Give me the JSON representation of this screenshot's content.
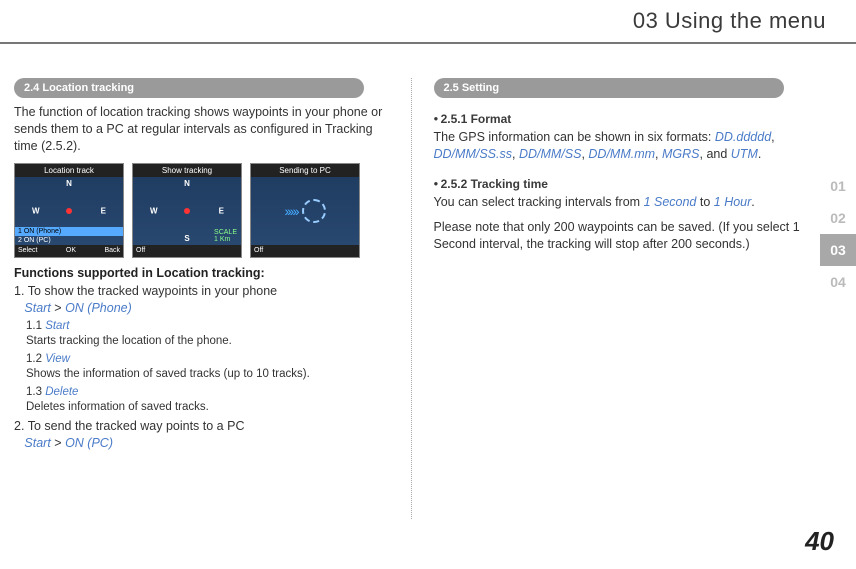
{
  "pageTitle": "03 Using the menu",
  "pageNumber": "40",
  "sideTabs": {
    "t1": "01",
    "t2": "02",
    "t3": "03",
    "t4": "04"
  },
  "left": {
    "pill": "2.4  Location tracking",
    "intro": "The function of location tracking shows waypoints in your phone or sends them to a PC at regular intervals as configured in Tracking time (2.5.2).",
    "ss1": {
      "title": "Location track",
      "menu1": "1 ON (Phone)",
      "menu2": "2 ON (PC)",
      "fl": "Select",
      "fc": "OK",
      "fr": "Back"
    },
    "ss2": {
      "title": "Show tracking",
      "scale": "SCALE",
      "km": "1 Km",
      "fl": "Off"
    },
    "ss3": {
      "title": "Sending to PC",
      "fl": "Off"
    },
    "subhead": "Functions supported in Location tracking:",
    "item1_num": "1.",
    "item1_text": "To show the tracked waypoints in your phone",
    "item1_path_a": "Start",
    "item1_gt": " > ",
    "item1_path_b": "ON (Phone)",
    "sub11_num": "1.1 ",
    "sub11_link": "Start",
    "sub11_desc": "Starts tracking the location of the phone.",
    "sub12_num": "1.2 ",
    "sub12_link": "View",
    "sub12_desc": "Shows the information of saved tracks (up to 10 tracks).",
    "sub13_num": "1.3 ",
    "sub13_link": "Delete",
    "sub13_desc": "Deletes information of saved tracks.",
    "item2_num": "2.",
    "item2_text": "To send the tracked way points to a PC",
    "item2_path_a": "Start",
    "item2_gt": " > ",
    "item2_path_b": "ON (PC)"
  },
  "right": {
    "pill": "2.5  Setting",
    "h251": "2.5.1  Format",
    "p251_a": "The GPS information can be shown in six formats: ",
    "f1": "DD.ddddd",
    "c": ", ",
    "f2": "DD/MM/SS.ss",
    "f3": "DD/MM/SS",
    "f4": "DD/MM.mm",
    "f5": "MGRS",
    "and": ", and ",
    "f6": "UTM",
    "period": ".",
    "h252": "2.5.2  Tracking time",
    "p252_a": "You can select tracking intervals from ",
    "t1": "1 Second",
    "to": " to ",
    "t2": "1 Hour",
    "p252_note": "Please note that only 200 waypoints can be saved. (If you select 1 Second interval, the tracking will stop after 200 seconds.)"
  }
}
